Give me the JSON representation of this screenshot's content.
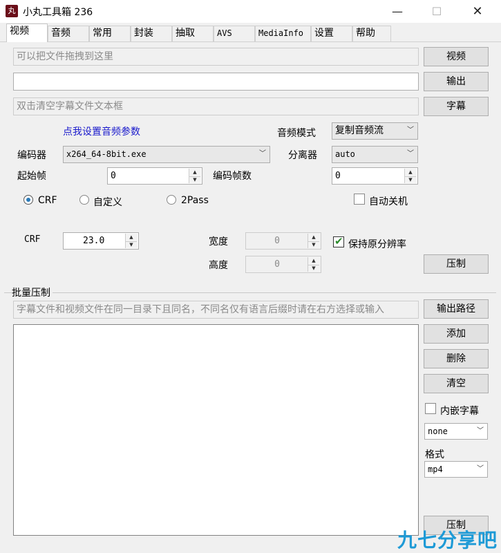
{
  "window": {
    "title": "小丸工具箱 236",
    "icon_text": "丸",
    "min_glyph": "—",
    "max_glyph": "☐",
    "close_glyph": "✕"
  },
  "tabs": [
    {
      "label": "视频",
      "active": true
    },
    {
      "label": "音频"
    },
    {
      "label": "常用"
    },
    {
      "label": "封装"
    },
    {
      "label": "抽取"
    },
    {
      "label": "AVS"
    },
    {
      "label": "MediaInfo"
    },
    {
      "label": "设置"
    },
    {
      "label": "帮助"
    }
  ],
  "video": {
    "video_input_placeholder": "可以把文件拖拽到这里",
    "output_input_value": "",
    "subtitle_input_placeholder": "双击清空字幕文件文本框",
    "video_button": "视频",
    "output_button": "输出",
    "subtitle_button": "字幕",
    "audio_params_link": "点我设置音频参数",
    "audio_mode_label": "音频模式",
    "audio_mode_value": "复制音频流",
    "encoder_label": "编码器",
    "encoder_value": "x264_64-8bit.exe",
    "demuxer_label": "分离器",
    "demuxer_value": "auto",
    "start_frame_label": "起始帧",
    "start_frame_value": "0",
    "encode_frames_label": "编码帧数",
    "encode_frames_value": "0",
    "mode_crf": "CRF",
    "mode_custom": "自定义",
    "mode_2pass": "2Pass",
    "auto_shutdown_label": "自动关机",
    "crf_label": "CRF",
    "crf_value": "23.0",
    "width_label": "宽度",
    "width_value": "0",
    "height_label": "高度",
    "height_value": "0",
    "keep_res_label": "保持原分辨率",
    "compress_button": "压制"
  },
  "batch": {
    "group_label": "批量压制",
    "hint_placeholder": "字幕文件和视频文件在同一目录下且同名，不同名仅有语言后缀时请在右方选择或输入",
    "output_path_button": "输出路径",
    "add_button": "添加",
    "delete_button": "删除",
    "clear_button": "清空",
    "embed_sub_label": "内嵌字幕",
    "sub_lang_value": "none",
    "format_label": "格式",
    "format_value": "mp4",
    "compress_button": "压制"
  },
  "watermark": "九七分享吧",
  "colors": {
    "link": "#1a1acc",
    "accent": "#2a7ab8",
    "watermark": "#1e9ad6",
    "icon_bg": "#6b0f1a"
  }
}
